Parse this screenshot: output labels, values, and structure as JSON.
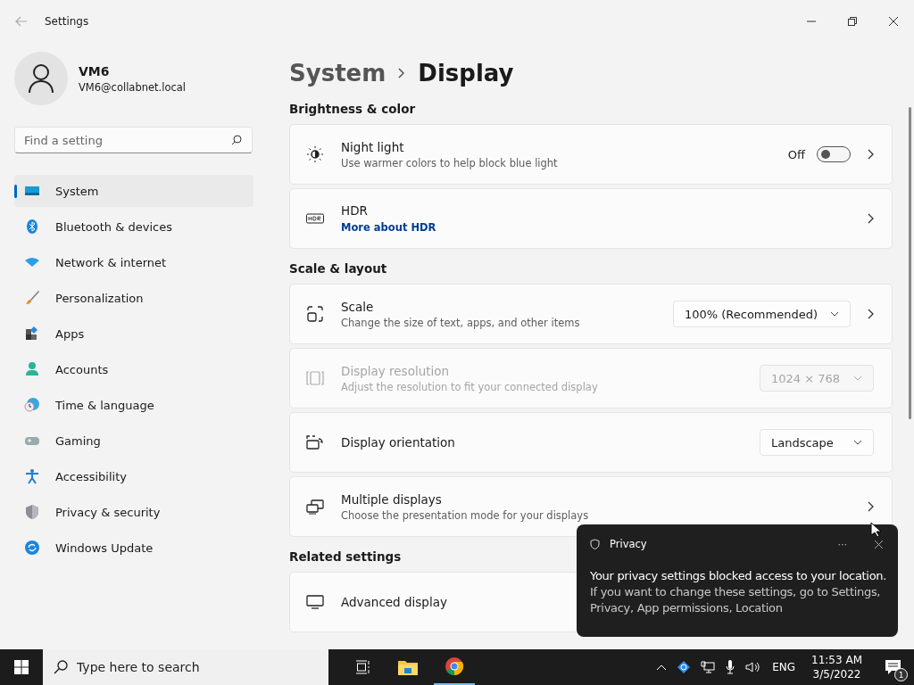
{
  "window": {
    "title": "Settings"
  },
  "profile": {
    "name": "VM6",
    "email": "VM6@collabnet.local"
  },
  "search": {
    "placeholder": "Find a setting"
  },
  "sidebar": {
    "items": [
      {
        "label": "System",
        "selected": true
      },
      {
        "label": "Bluetooth & devices",
        "selected": false
      },
      {
        "label": "Network & internet",
        "selected": false
      },
      {
        "label": "Personalization",
        "selected": false
      },
      {
        "label": "Apps",
        "selected": false
      },
      {
        "label": "Accounts",
        "selected": false
      },
      {
        "label": "Time & language",
        "selected": false
      },
      {
        "label": "Gaming",
        "selected": false
      },
      {
        "label": "Accessibility",
        "selected": false
      },
      {
        "label": "Privacy & security",
        "selected": false
      },
      {
        "label": "Windows Update",
        "selected": false
      }
    ]
  },
  "breadcrumb": {
    "parent": "System",
    "current": "Display"
  },
  "sections": [
    {
      "title": "Brightness & color",
      "cards": [
        {
          "kind": "toggle",
          "title": "Night light",
          "subtitle": "Use warmer colors to help block blue light",
          "toggle_label": "Off",
          "on": false,
          "disabled": false
        },
        {
          "kind": "link",
          "title": "HDR",
          "link": "More about HDR",
          "disabled": false
        }
      ]
    },
    {
      "title": "Scale & layout",
      "cards": [
        {
          "kind": "dropdown",
          "title": "Scale",
          "subtitle": "Change the size of text, apps, and other items",
          "value": "100% (Recommended)",
          "chevron": true,
          "disabled": false
        },
        {
          "kind": "dropdown",
          "title": "Display resolution",
          "subtitle": "Adjust the resolution to fit your connected display",
          "value": "1024 × 768",
          "chevron": false,
          "disabled": true
        },
        {
          "kind": "dropdown",
          "title": "Display orientation",
          "value": "Landscape",
          "chevron": false,
          "disabled": false
        },
        {
          "kind": "nav",
          "title": "Multiple displays",
          "subtitle": "Choose the presentation mode for your displays",
          "disabled": false
        }
      ]
    },
    {
      "title": "Related settings",
      "cards": [
        {
          "kind": "nav",
          "title": "Advanced display",
          "disabled": false
        }
      ]
    }
  ],
  "toast": {
    "app": "Privacy",
    "more": "···",
    "title": "Your privacy settings blocked access to your location.",
    "body": "If you want to change these settings, go to Settings, Privacy, App permissions, Location"
  },
  "taskbar": {
    "search_placeholder": "Type here to search",
    "language": "ENG",
    "time": "11:53 AM",
    "date": "3/5/2022",
    "notification_count": "1"
  }
}
